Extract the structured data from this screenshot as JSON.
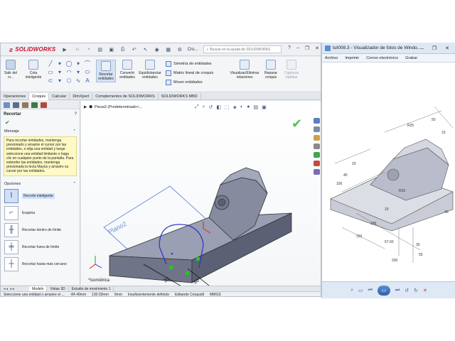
{
  "solidworks": {
    "brand": "SOLIDWORKS",
    "doc_title": "Cro...",
    "search_placeholder": "Buscar en la ayuda de SOLIDWORKS",
    "commands": {
      "exit_sketch": "Salir del cr...",
      "smart_dim": "Cota inteligente",
      "trim": "Recortar entidades",
      "convert": "Convertir entidades",
      "offset": "Equidistanciar entidades",
      "mirror": "Simetría de entidades",
      "linear_pattern": "Matriz lineal de croquis",
      "move": "Mover entidades",
      "display_delete": "Visualizar/Eliminar relaciones",
      "repair": "Reparar croquis",
      "quick_snaps": "Capturas rápidas"
    },
    "tabs": [
      "Operaciones",
      "Croquis",
      "Calcular",
      "DimXpert",
      "Complementos de SOLIDWORKS",
      "SOLIDWORKS MBD"
    ],
    "active_tab": "Croquis",
    "tree_item": "Pieza3 (Predeterminado<...",
    "panel": {
      "title": "Recortar",
      "help": "?",
      "message_title": "Mensaje",
      "message_text": "Para recortar entidades, mantenga presionado y arrastre el cursor por las entidades, o elija una entidad y luego seleccione una entidad limitante o haga clic en cualquier punto de la pantalla. Para extender las entidades, mantenga presionada la tecla Mayús y arrastre su cursor por las entidades.",
      "options_title": "Opciones",
      "options": [
        "Recorte inteligente",
        "Esquina",
        "Recortar dentro de límite",
        "Recortar fuera de límite",
        "Recortar hasta más cercano"
      ]
    },
    "viewport": {
      "plane_label": "Plano2",
      "view_label": "*Isométrica",
      "dims": [
        "30",
        "50",
        "15"
      ]
    },
    "bottom_tabs": [
      "Modelo",
      "Vistas 3D",
      "Estudio de movimiento 1"
    ],
    "status": {
      "hint": "Seleccione una entidad o arrastre el ...",
      "x": "-84.49mm",
      "y": "130.03mm",
      "z": "0mm",
      "defined": "Insuficientemente definido",
      "editing": "Editando Croquis8",
      "units": "MMGS"
    }
  },
  "photo_viewer": {
    "title": "tut008.3 - Visualizador de fotos de Windo...",
    "controls": "–  ❐  ✕",
    "menu": [
      "Archivo",
      "Imprimir",
      "Correo electrónico",
      "Grabar"
    ],
    "drawing_dims": [
      "R25",
      "50",
      "15",
      "20",
      "100",
      "40",
      "R10",
      "10",
      "57.60",
      "100",
      "150",
      "200",
      "30",
      "55",
      "40"
    ]
  },
  "colors": {
    "accent": "#2f5ea8",
    "brand": "#c8102e",
    "model": "#8f95ab",
    "message_bg": "#fff9c4"
  }
}
